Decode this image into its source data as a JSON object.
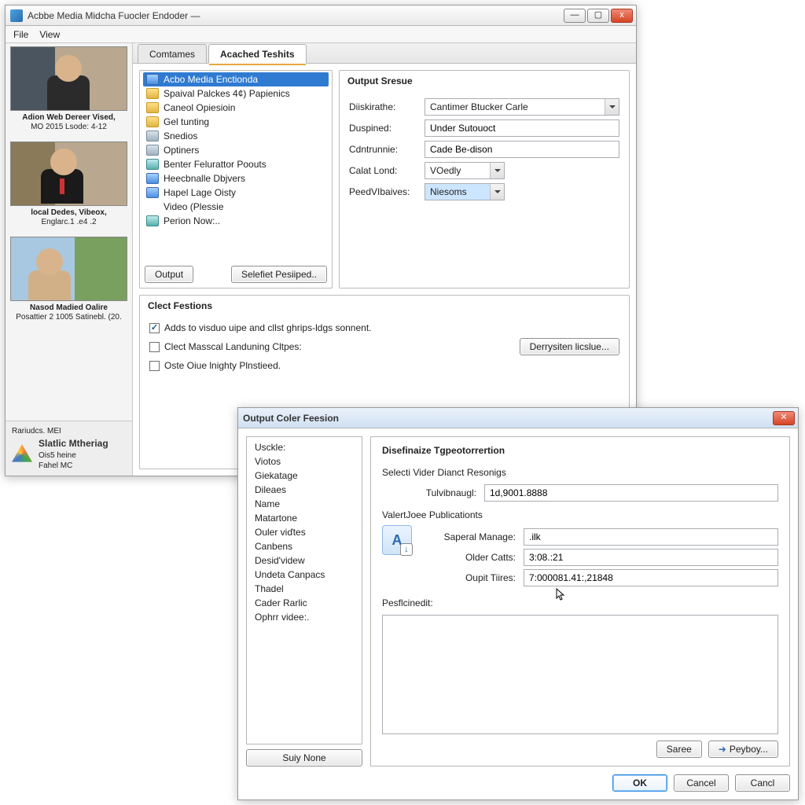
{
  "main_window": {
    "title": "Acbbe Media Midcha Fuocler Endoder —",
    "menu": {
      "file": "File",
      "view": "View"
    },
    "tabs": {
      "t1": "Comtames",
      "t2": "Acached Teshits"
    },
    "thumbnails": [
      {
        "line1": "Adion Web Dereer Vised,",
        "line2": "MO 2015 Lsode: 4-12"
      },
      {
        "line1": "local Dedes, Vibeox,",
        "line2": "Englarc.1 .e4 .2"
      },
      {
        "line1": "Nasod Madied Oalire",
        "line2": "Posattier 2 1005 Satinebl. (20."
      }
    ],
    "tree": [
      "Acbo Media Enctionda",
      "Spaival Palckes 4¢) Papienics",
      "Caneol Opiesioin",
      "Gel tunting",
      "Snedios",
      "Optiners",
      "Benter Felurattor Poouts",
      "Heecbnalle Dbjvers",
      "Hapel Lage Oisty",
      "Video (Plessie",
      "Perion Now:.."
    ],
    "tree_buttons": {
      "output": "Output",
      "select": "Selefiet Pesiiped.."
    },
    "output_panel": {
      "legend": "Output Sresue",
      "labels": {
        "diskirathe": "Diiskirathe:",
        "dusplned": "Duspined:",
        "corunnie": "Cdntrunnie:",
        "calatond": "Calat Lond:",
        "peedv": "PeedVIbaives:"
      },
      "values": {
        "diskirathe": "Cantimer Btucker Carle",
        "dusplned": "Under Sutouoct",
        "corunnie": "Cade Be-dison",
        "calatond": "VOedly",
        "peedv": "Niesoms"
      }
    },
    "festions_panel": {
      "legend": "Clect Festions",
      "opt1": "Adds to visduo uipe and cllst ghrips-ldgs sonnent.",
      "opt2": "Clect Masscal Landuning Cltpes:",
      "opt3": "Oste Oiue lnighty Plnstieed.",
      "btn": "Derrysiten licslue..."
    },
    "sidebar_bottom": {
      "line1": "Rariudcs. MEI",
      "line2": "Slatlic Mtheriag",
      "line3": "Ois5 heine",
      "line4": "Fahel MC"
    },
    "win_controls": {
      "min": "—",
      "max": "▢",
      "close": "x"
    }
  },
  "dialog": {
    "title": "Output Coler Feesion",
    "list": [
      "Usckle:",
      "Viotos",
      "Giekatage",
      "Dileaes",
      "Name",
      "Matartone",
      "Ouler viďtes",
      "Canbens",
      "Desid'videw",
      "Undeta Canpacs",
      "Thadel",
      "Cader Rarlic",
      "Ophrr videe:."
    ],
    "list_btn": "Suiy None",
    "right": {
      "heading": "Disefinaize Tgpeotorrertion",
      "sec1": "Selecti Vider Dianct Resonigs",
      "row1_label": "Tulvibnaugl:",
      "row1_value": "1d,9001.8888",
      "sec2": "ValertJoee Publicationts",
      "pub_label1": "Saperal Manage:",
      "pub_val1": ".ilk",
      "pub_label2": "Older Catts:",
      "pub_val2": "3:08.:21",
      "pub_label3": "Oupit Tiires:",
      "pub_val3": "7:000081.41:,21848",
      "pesf_label": "Pesflcinedit:",
      "btn_save": "Saree",
      "btn_pey": "Peyboy..."
    },
    "footer": {
      "ok": "OK",
      "cancel": "Cancel",
      "cancl": "Cancl"
    },
    "icon_letter": "A"
  }
}
